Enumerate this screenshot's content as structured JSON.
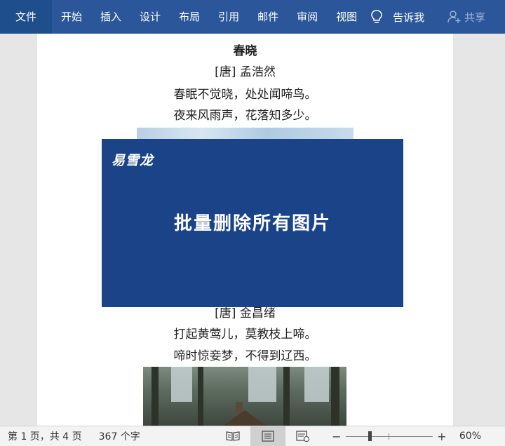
{
  "ribbon": {
    "tabs": [
      "文件",
      "开始",
      "插入",
      "设计",
      "布局",
      "引用",
      "邮件",
      "审阅",
      "视图"
    ],
    "tell_me": "告诉我",
    "share": "共享",
    "color": "#2b579a"
  },
  "document": {
    "poem1": {
      "title": "春晓",
      "author": "[唐]  孟浩然",
      "lines": [
        "春眠不觉晓，处处闻啼鸟。",
        "夜来风雨声，花落知多少。"
      ]
    },
    "poem2": {
      "author": "[唐]  金昌绪",
      "lines": [
        "打起黄莺儿，莫教枝上啼。",
        "啼时惊妾梦，不得到辽西。"
      ]
    }
  },
  "banner": {
    "logo": "易雪龙",
    "headline": "批量删除所有图片",
    "color": "#1a4388"
  },
  "status_bar": {
    "page_info": "第 1 页，共 4 页",
    "word_count": "367 个字",
    "zoom_minus": "−",
    "zoom_plus": "+",
    "zoom_level": "60%",
    "zoom_value": 60,
    "icons": [
      "read-mode-icon",
      "print-layout-icon",
      "web-layout-icon"
    ]
  }
}
